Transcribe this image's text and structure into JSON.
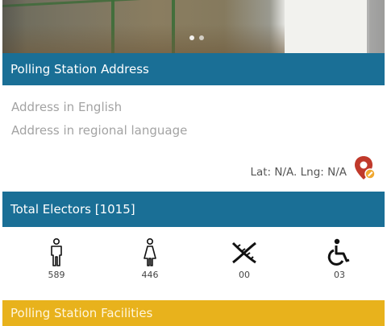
{
  "carousel": {
    "slides": 2,
    "active_index": 0
  },
  "address_section": {
    "title": "Polling Station Address",
    "address_english": "Address in English",
    "address_regional": "Address in regional language",
    "lat_lng": "Lat: N/A. Lng: N/A",
    "map_icon": "location-pin-icon"
  },
  "electors_section": {
    "title": "Total Electors [1015]",
    "stats": [
      {
        "icon": "male-icon",
        "value": "589"
      },
      {
        "icon": "female-icon",
        "value": "446"
      },
      {
        "icon": "third-gender-icon",
        "value": "00"
      },
      {
        "icon": "wheelchair-icon",
        "value": "03"
      }
    ]
  },
  "facilities_section": {
    "title": "Polling Station Facilities"
  },
  "colors": {
    "header_blue": "#1a6f96",
    "facilities_yellow": "#e8b21c",
    "pin_red": "#c0392b",
    "pin_badge": "#f0a830"
  }
}
